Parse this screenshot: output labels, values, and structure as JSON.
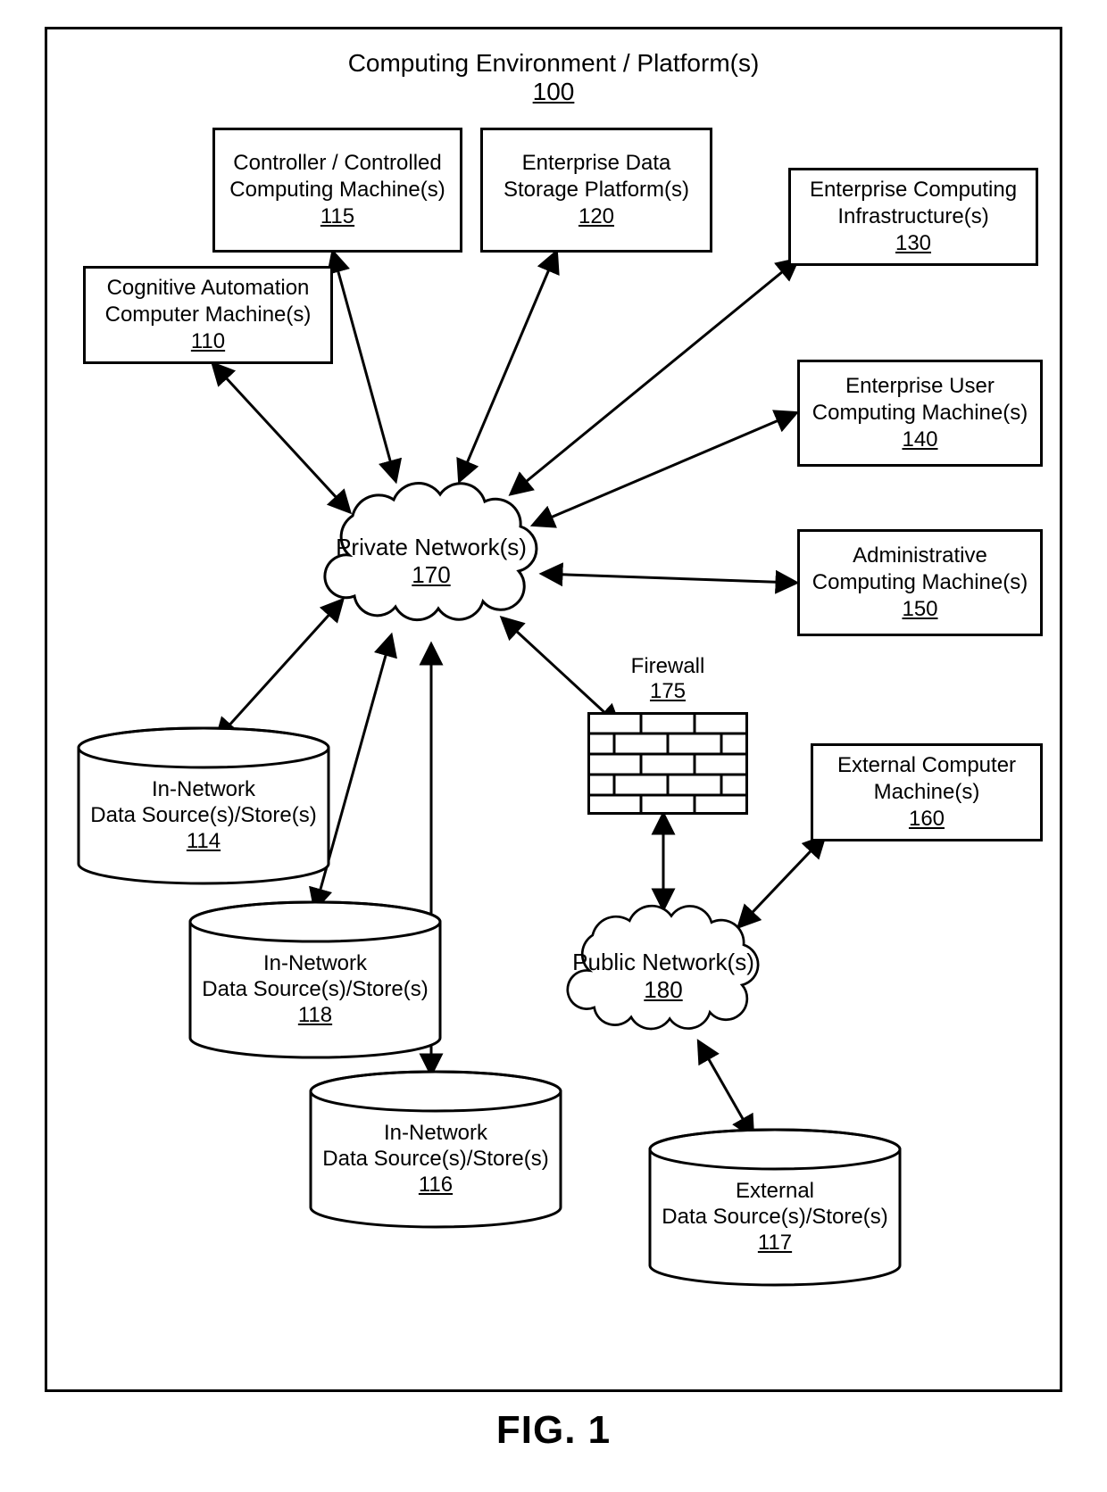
{
  "title": {
    "label": "Computing Environment / Platform(s)",
    "ref": "100"
  },
  "figure": "FIG. 1",
  "nodes": {
    "b110": {
      "l1": "Cognitive Automation",
      "l2": "Computer Machine(s)",
      "ref": "110"
    },
    "b115": {
      "l1": "Controller / Controlled",
      "l2": "Computing Machine(s)",
      "ref": "115"
    },
    "b120": {
      "l1": "Enterprise Data",
      "l2": "Storage Platform(s)",
      "ref": "120"
    },
    "b130": {
      "l1": "Enterprise Computing",
      "l2": "Infrastructure(s)",
      "ref": "130"
    },
    "b140": {
      "l1": "Enterprise User",
      "l2": "Computing Machine(s)",
      "ref": "140"
    },
    "b150": {
      "l1": "Administrative",
      "l2": "Computing Machine(s)",
      "ref": "150"
    },
    "b160": {
      "l1": "External Computer",
      "l2": "Machine(s)",
      "ref": "160"
    },
    "c114": {
      "l1": "In-Network",
      "l2": "Data Source(s)/Store(s)",
      "ref": "114"
    },
    "c118": {
      "l1": "In-Network",
      "l2": "Data Source(s)/Store(s)",
      "ref": "118"
    },
    "c116": {
      "l1": "In-Network",
      "l2": "Data Source(s)/Store(s)",
      "ref": "116"
    },
    "c117": {
      "l1": "External",
      "l2": "Data Source(s)/Store(s)",
      "ref": "117"
    },
    "n170": {
      "l1": "Private Network(s)",
      "ref": "170"
    },
    "n180": {
      "l1": "Public Network(s)",
      "ref": "180"
    },
    "fw": {
      "l1": "Firewall",
      "ref": "175"
    }
  }
}
